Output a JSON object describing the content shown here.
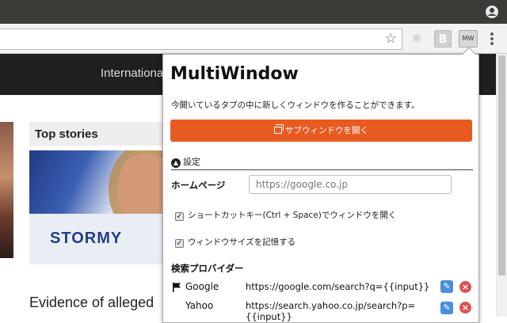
{
  "browser": {
    "address_value": "",
    "extensions": [
      {
        "name": "react-devtools-icon",
        "glyph": "⚛"
      },
      {
        "name": "bootstrap-icon",
        "glyph": "B"
      },
      {
        "name": "multiwindow-icon",
        "glyph": "MW"
      }
    ]
  },
  "page": {
    "nav_item": "Internationa",
    "section_title": "Top stories",
    "image_text": "STORMY",
    "headline": "Evidence of alleged"
  },
  "popup": {
    "title": "MultiWindow",
    "description": "今開いているタブの中に新しくウィンドウを作ることができます。",
    "open_button_label": "サブウィンドウを開く",
    "settings_label": "設定",
    "homepage_label": "ホームページ",
    "homepage_placeholder": "https://google.co.jp",
    "homepage_value": "",
    "checkboxes": [
      {
        "label": "ショートカットキー(Ctrl + Space)でウィンドウを開く",
        "checked": true
      },
      {
        "label": "ウィンドウサイズを記憶する",
        "checked": true
      }
    ],
    "search_providers_label": "検索プロバイダー",
    "providers": [
      {
        "name": "Google",
        "url": "https://google.com/search?q={{input}}",
        "default": true
      },
      {
        "name": "Yahoo",
        "url_line1": "https://search.yahoo.co.jp/search?p=",
        "url_line2": "{{input}}",
        "default": false
      }
    ],
    "accent_color": "#e95a21"
  }
}
